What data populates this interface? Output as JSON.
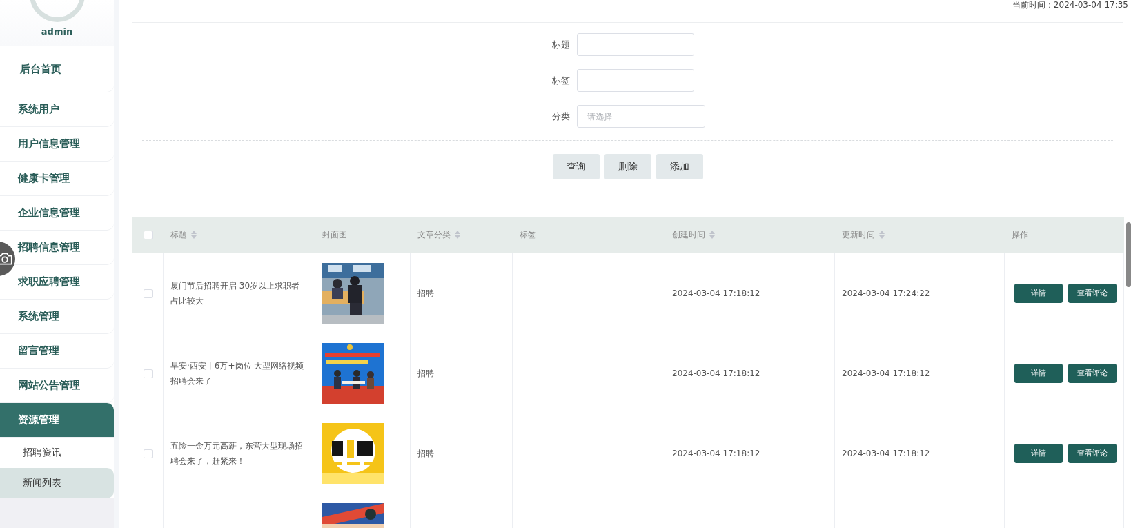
{
  "user": {
    "name": "admin"
  },
  "sidebar": {
    "items": [
      {
        "label": "后台首页",
        "kind": "home",
        "selected": false
      },
      {
        "label": "系统用户",
        "kind": "menu",
        "selected": false
      },
      {
        "label": "用户信息管理",
        "kind": "menu",
        "selected": false
      },
      {
        "label": "健康卡管理",
        "kind": "menu",
        "selected": false
      },
      {
        "label": "企业信息管理",
        "kind": "menu",
        "selected": false
      },
      {
        "label": "招聘信息管理",
        "kind": "menu",
        "selected": false
      },
      {
        "label": "求职应聘管理",
        "kind": "menu",
        "selected": false
      },
      {
        "label": "系统管理",
        "kind": "menu",
        "selected": false
      },
      {
        "label": "留言管理",
        "kind": "menu",
        "selected": false
      },
      {
        "label": "网站公告管理",
        "kind": "menu",
        "selected": false
      },
      {
        "label": "资源管理",
        "kind": "menu",
        "selected": true,
        "expanded": true,
        "children": [
          {
            "label": "招聘资讯",
            "selected": false
          },
          {
            "label": "新闻列表",
            "selected": true
          }
        ]
      }
    ]
  },
  "header": {
    "clock": "当前时间：2024-03-04 17:35"
  },
  "search": {
    "fields": [
      {
        "label": "标题",
        "kind": "input"
      },
      {
        "label": "标签",
        "kind": "input"
      },
      {
        "label": "分类",
        "kind": "select",
        "placeholder": "请选择"
      }
    ],
    "buttons": [
      "查询",
      "删除",
      "添加"
    ]
  },
  "table": {
    "select_all": {
      "checked": false
    },
    "columns": [
      {
        "label": "标题",
        "sortable": true
      },
      {
        "label": "封面图",
        "sortable": false
      },
      {
        "label": "文章分类",
        "sortable": true
      },
      {
        "label": "标签",
        "sortable": false
      },
      {
        "label": "创建时间",
        "sortable": true
      },
      {
        "label": "更新时间",
        "sortable": true
      },
      {
        "label": "操作",
        "sortable": false
      }
    ],
    "rows": [
      {
        "checked": false,
        "title": "厦门节后招聘开启 30岁以上求职者占比较大",
        "cover": {
          "kind": "picture"
        },
        "category": "招聘",
        "created": "2024-03-04 17:18:12",
        "updated": "2024-03-04 17:24:22",
        "actions": [
          "详情",
          "查看评论"
        ]
      },
      {
        "checked": false,
        "title": "早安·西安丨6万+岗位 大型网络视频招聘会来了",
        "cover": {
          "kind": "picture"
        },
        "category": "招聘",
        "created": "2024-03-04 17:18:12",
        "updated": "2024-03-04 17:18:12",
        "actions": [
          "详情",
          "查看评论"
        ]
      },
      {
        "checked": false,
        "title": "五险一金万元高薪，东营大型现场招聘会来了，赶紧来！",
        "cover": {
          "kind": "picture"
        },
        "category": "招聘",
        "created": "2024-03-04 17:18:12",
        "updated": "2024-03-04 17:18:12",
        "actions": [
          "详情",
          "查看评论"
        ]
      },
      {
        "cover": {
          "kind": "picture"
        }
      }
    ]
  }
}
